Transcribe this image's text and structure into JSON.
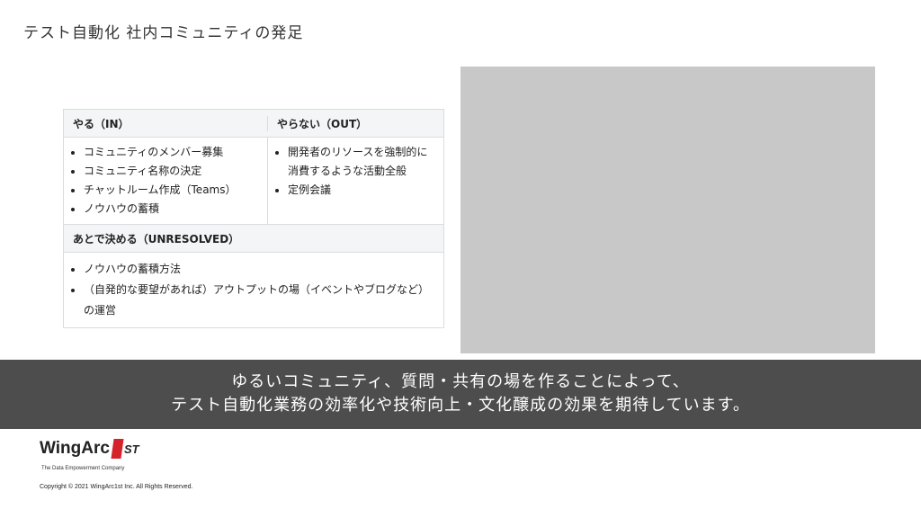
{
  "title": "テスト自動化 社内コミュニティの発足",
  "table": {
    "in_header": "やる（IN）",
    "out_header": "やらない（OUT）",
    "in_items": [
      "コミュニティのメンバー募集",
      "コミュニティ名称の決定",
      "チャットルーム作成（Teams）",
      "ノウハウの蓄積"
    ],
    "out_items": [
      "開発者のリソースを強制的に消費するような活動全般",
      "定例会議"
    ],
    "unresolved_header": "あとで決める（UNRESOLVED）",
    "unresolved_items": [
      "ノウハウの蓄積方法",
      "（自発的な要望があれば）アウトプットの場（イベントやブログなど）の運営"
    ]
  },
  "banner": {
    "line1": "ゆるいコミュニティ、質問・共有の場を作ることによって、",
    "line2": "テスト自動化業務の効率化や技術向上・文化醸成の効果を期待しています。"
  },
  "logo": {
    "wordmark": "WingArc",
    "mark_suffix": "ST",
    "tagline": "The Data Empowerment Company",
    "brand_color": "#d4232a"
  },
  "copyright": "Copyright © 2021 WingArc1st Inc.  All Rights Reserved.",
  "colors": {
    "banner_bg": "#4d4d4d",
    "placeholder_bg": "#c8c8c8",
    "table_header_bg": "#f4f5f7"
  }
}
